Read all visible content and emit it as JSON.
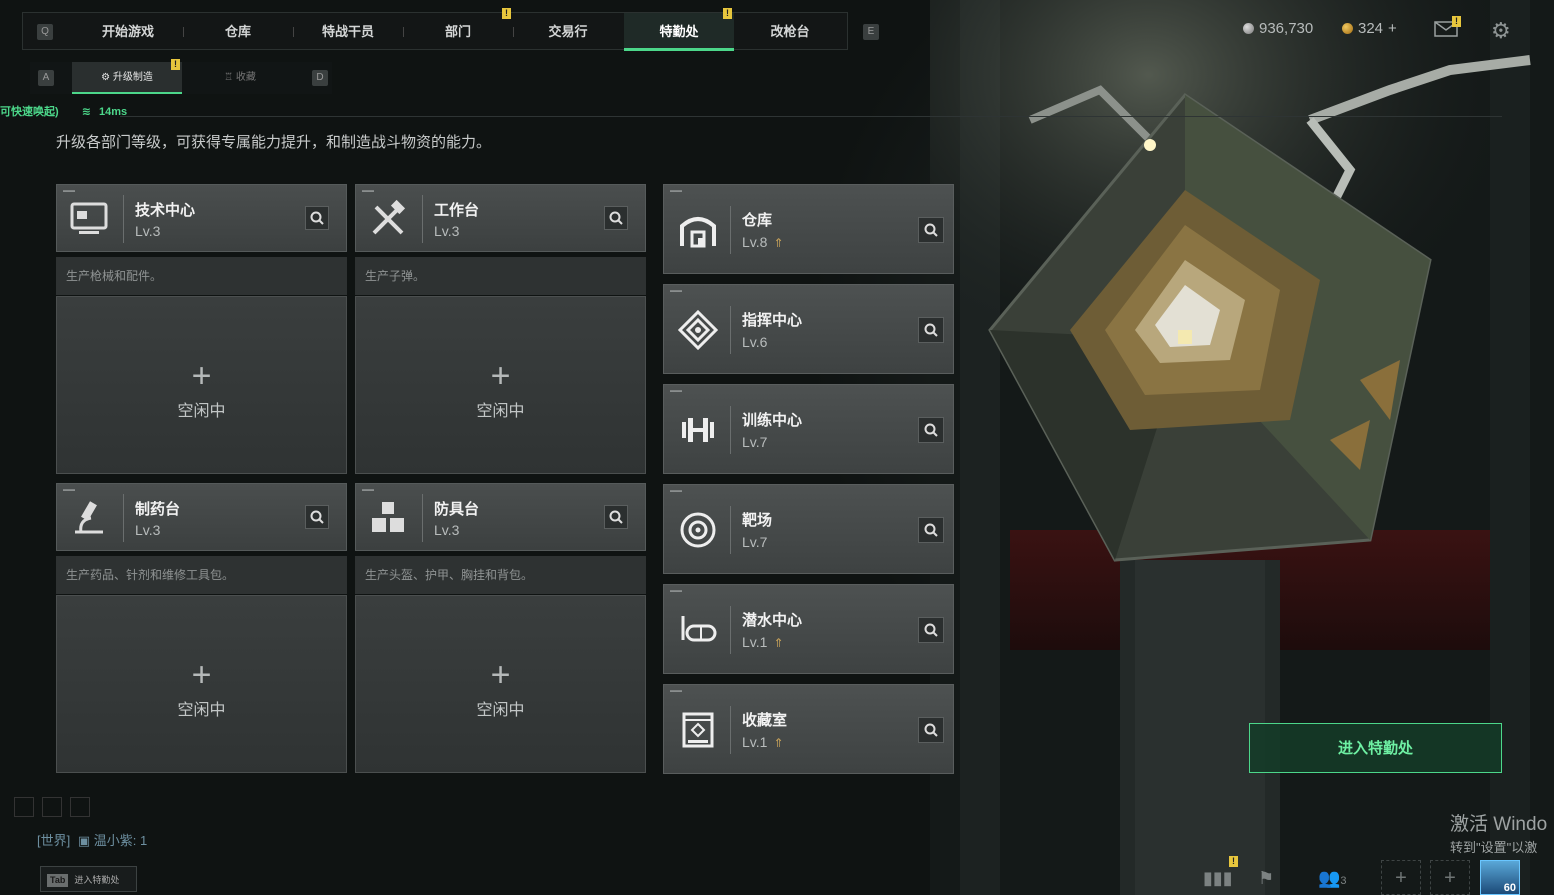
{
  "top_tabs": [
    {
      "label": "开始游戏"
    },
    {
      "label": "仓库"
    },
    {
      "label": "特战干员"
    },
    {
      "label": "部门"
    },
    {
      "label": "交易行"
    },
    {
      "label": "特勤处",
      "active": true
    },
    {
      "label": "改枪台"
    }
  ],
  "keys": {
    "left": "Q",
    "right": "E",
    "sub_left": "A",
    "sub_right": "D"
  },
  "sub_tabs": [
    {
      "label": "升级制造",
      "active": true
    },
    {
      "label": "收藏"
    }
  ],
  "currency": {
    "silver": "936,730",
    "gold": "324",
    "gold_plus": "+"
  },
  "status": {
    "wake": "可快速唤起)",
    "ping": "14ms"
  },
  "description": "升级各部门等级，可获得专属能力提升，和制造战斗物资的能力。",
  "workshops": [
    {
      "name": "技术中心",
      "level": "Lv.3",
      "desc": "生产枪械和配件。",
      "slot": "空闲中",
      "icon": "computer-icon"
    },
    {
      "name": "工作台",
      "level": "Lv.3",
      "desc": "生产子弹。",
      "slot": "空闲中",
      "icon": "tools-icon"
    },
    {
      "name": "制药台",
      "level": "Lv.3",
      "desc": "生产药品、针剂和维修工具包。",
      "slot": "空闲中",
      "icon": "microscope-icon"
    },
    {
      "name": "防具台",
      "level": "Lv.3",
      "desc": "生产头盔、护甲、胸挂和背包。",
      "slot": "空闲中",
      "icon": "armor-icon"
    }
  ],
  "departments": [
    {
      "name": "仓库",
      "level": "Lv.8",
      "upgrade": true,
      "icon": "warehouse-icon"
    },
    {
      "name": "指挥中心",
      "level": "Lv.6",
      "upgrade": false,
      "icon": "command-icon"
    },
    {
      "name": "训练中心",
      "level": "Lv.7",
      "upgrade": false,
      "icon": "dumbbell-icon"
    },
    {
      "name": "靶场",
      "level": "Lv.7",
      "upgrade": false,
      "icon": "target-icon"
    },
    {
      "name": "潜水中心",
      "level": "Lv.1",
      "upgrade": true,
      "icon": "diving-mask-icon"
    },
    {
      "name": "收藏室",
      "level": "Lv.1",
      "upgrade": true,
      "icon": "collection-icon"
    }
  ],
  "enter_button": "进入特勤处",
  "chat": {
    "channel": "[世界]",
    "user": "温小紫: 1"
  },
  "tab_hint": {
    "key": "Tab",
    "label": "进入特勤处"
  },
  "watermark": {
    "line1": "激活 Windo",
    "line2": "转到\"设置\"以激"
  },
  "bottom": {
    "friends_count": "3",
    "level": "60"
  },
  "colors": {
    "accent": "#4cd78a",
    "warning": "#e7c63d",
    "upgrade": "#c8a25a"
  }
}
